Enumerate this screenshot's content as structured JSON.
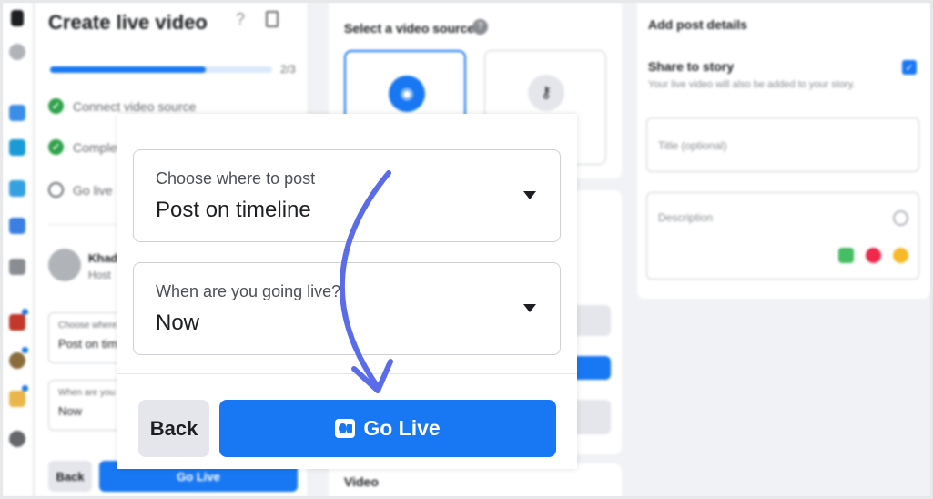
{
  "background": {
    "create_panel": {
      "title": "Create live video",
      "help_glyph": "?",
      "progress_fraction": 0.7,
      "progress_count": "2/3",
      "steps": [
        {
          "label": "Connect video source",
          "status": "done"
        },
        {
          "label": "Complete",
          "status": "done"
        },
        {
          "label": "Go live",
          "status": "pending"
        }
      ],
      "user": {
        "name": "Khadi",
        "role": "Host"
      },
      "mini_where": {
        "label": "Choose where",
        "value": "Post on tim"
      },
      "mini_when": {
        "label": "When are you",
        "value": "Now"
      },
      "back_label": "Back",
      "golive_label": "Go Live"
    },
    "video_source": {
      "title": "Select a video source",
      "help_glyph": "?",
      "video_section": "Video"
    },
    "post_details": {
      "title": "Add post details",
      "share_story_label": "Share to story",
      "share_story_sub": "Your live video will also be added to your story.",
      "share_story_checked": true,
      "title_placeholder": "Title (optional)",
      "description_placeholder": "Description"
    }
  },
  "modal": {
    "where_field": {
      "label": "Choose where to post",
      "value": "Post on timeline"
    },
    "when_field": {
      "label": "When are you going live?",
      "value": "Now"
    },
    "back_label": "Back",
    "golive_label": "Go Live"
  },
  "colors": {
    "accent": "#1877f2",
    "arrow": "#5b6ce8",
    "success": "#31a24c",
    "page_bg": "#f0f2f5"
  },
  "icons": [
    "help-icon",
    "book-icon",
    "check-icon",
    "camera-icon",
    "key-icon",
    "chevron-down-icon",
    "live-video-icon",
    "tag-person-icon",
    "location-icon",
    "emoji-icon"
  ]
}
